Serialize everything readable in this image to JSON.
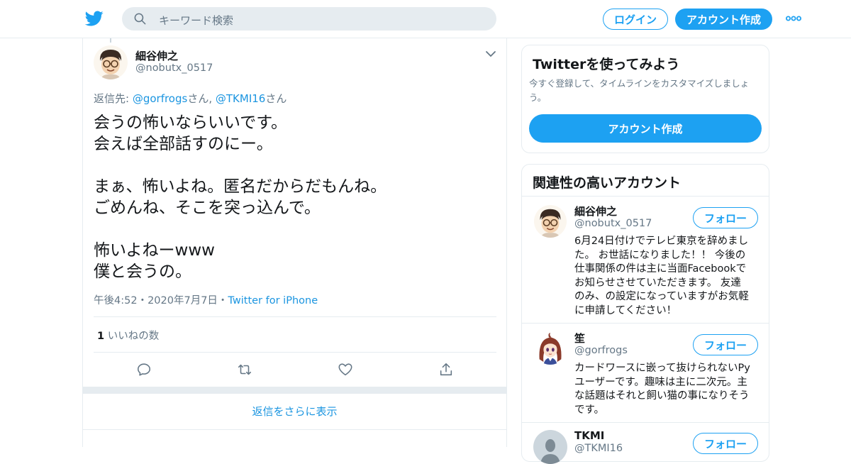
{
  "colors": {
    "accent": "#1da1f2",
    "link": "#1b95e0",
    "muted": "#657786",
    "border": "#e6ecf0"
  },
  "header": {
    "logo_icon": "twitter-bird-icon",
    "search_placeholder": "キーワード検索",
    "login_label": "ログイン",
    "signup_label": "アカウント作成",
    "more_icon": "more-dots-icon"
  },
  "tweet": {
    "author_name": "細谷伸之",
    "author_handle": "@nobutx_0517",
    "reply_prefix": "返信先: ",
    "reply_user1": "@gorfrogs",
    "reply_sep": "さん, ",
    "reply_user2": "@TKMI16",
    "reply_suffix": "さん",
    "lines": [
      "会うの怖いならいいです。",
      "会えば全部話すのにー。",
      "",
      "まぁ、怖いよね。匿名だからだもんね。",
      "ごめんね、そこを突っ込んで。",
      "",
      "怖いよねーwww",
      "僕と会うの。"
    ],
    "time": "午後4:52",
    "date": "2020年7月7日",
    "dot": "・",
    "source": "Twitter for iPhone",
    "like_count": "1",
    "like_label": "いいねの数",
    "actions": [
      "reply-icon",
      "retweet-icon",
      "like-icon",
      "share-icon"
    ]
  },
  "show_more_label": "返信をさらに表示",
  "signup_card": {
    "title": "Twitterを使ってみよう",
    "desc_line1": "今すぐ登録して、タイムラインをカスタマイズしましょ",
    "desc_line2": "う。",
    "button_label": "アカウント作成"
  },
  "related": {
    "title": "関連性の高いアカウント",
    "follow_label": "フォロー",
    "accounts": [
      {
        "name": "細谷伸之",
        "handle": "@nobutx_0517",
        "bio": [
          "6月24日付けでテレビ東京を辞めまし",
          "た。 お世話になりました！！ 今後の",
          "仕事関係の件は主に当面Facebookで",
          "お知らせさせていただきます。 友達",
          "のみ、の設定になっていますがお気軽",
          "に申請してください！"
        ]
      },
      {
        "name": "笙",
        "handle": "@gorfrogs",
        "bio": [
          "カードワースに嵌って抜けられないPy",
          "ユーザーです。趣味は主に二次元。主",
          "な話題はそれと飼い猫の事になりそう",
          "です。"
        ]
      },
      {
        "name": "TKMI",
        "handle": "@TKMI16",
        "bio": []
      }
    ]
  }
}
